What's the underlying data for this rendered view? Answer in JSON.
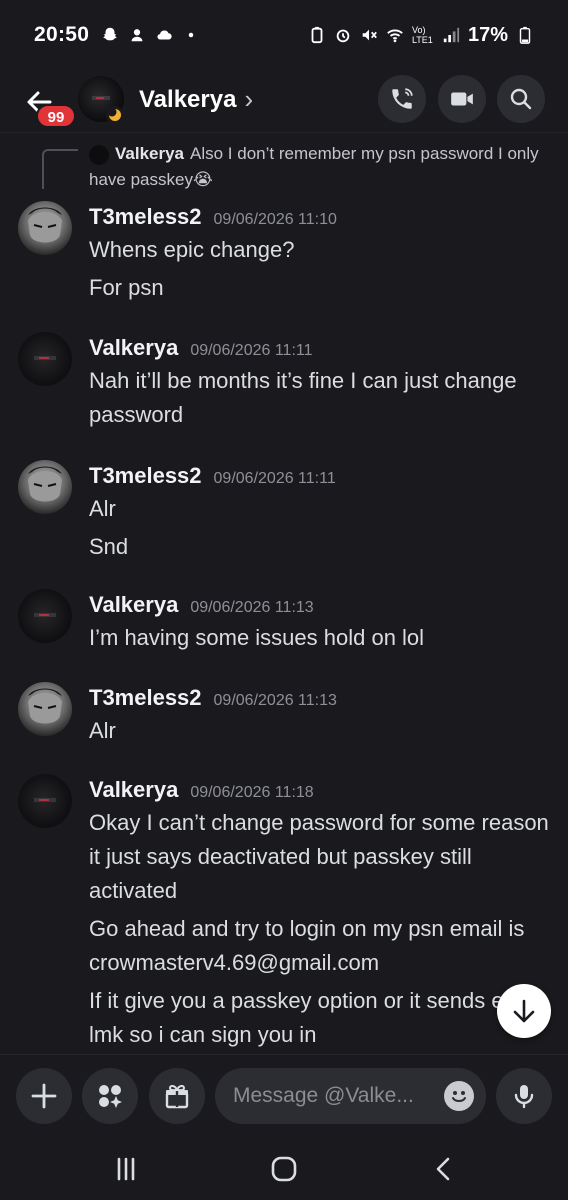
{
  "status_bar": {
    "time": "20:50",
    "network_label": "Vo) LTE1",
    "battery": "17%"
  },
  "header": {
    "unread_badge": "99",
    "title": "Valkerya",
    "chevron": "›"
  },
  "reply_preview": {
    "name": "Valkerya",
    "text": "Also I don’t remember my psn password I only have passkey😭"
  },
  "messages": [
    {
      "author": "T3meless2",
      "timestamp": "09/06/2026 11:10",
      "avatar": "t3meless-avatar",
      "lines": [
        "Whens epic change?",
        "For psn"
      ]
    },
    {
      "author": "Valkerya",
      "timestamp": "09/06/2026 11:11",
      "avatar": "valkerya-avatar",
      "lines": [
        "Nah it’ll be months it’s fine I can just change password"
      ]
    },
    {
      "author": "T3meless2",
      "timestamp": "09/06/2026 11:11",
      "avatar": "t3meless-avatar",
      "lines": [
        "Alr",
        "Snd"
      ]
    },
    {
      "author": "Valkerya",
      "timestamp": "09/06/2026 11:13",
      "avatar": "valkerya-avatar",
      "lines": [
        "I’m having some issues hold on lol"
      ]
    },
    {
      "author": "T3meless2",
      "timestamp": "09/06/2026 11:13",
      "avatar": "t3meless-avatar",
      "lines": [
        "Alr"
      ]
    },
    {
      "author": "Valkerya",
      "timestamp": "09/06/2026 11:18",
      "avatar": "valkerya-avatar",
      "lines": [
        "Okay I can’t change password for some reason it just says deactivated but passkey still activated",
        "Go ahead and try to login on my psn email is crowmasterv4.69@gmail.com",
        "If it give you a passkey option or it sends email lmk so i can sign you in"
      ]
    }
  ],
  "composer": {
    "placeholder": "Message @Valke..."
  },
  "colors": {
    "background": "#1a1a1e",
    "button_bg": "#2b2d32",
    "badge": "#e03438",
    "timestamp": "#8e9097"
  }
}
